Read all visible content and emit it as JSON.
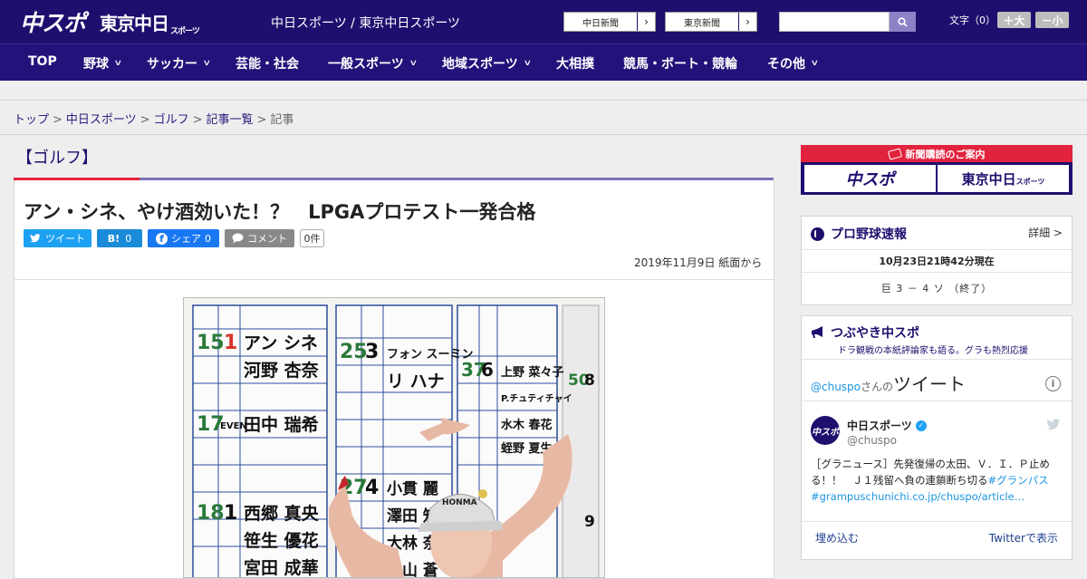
{
  "header": {
    "logo_chuspo": "中スポ",
    "logo_tokyo": "東京中日",
    "logo_tokyo_suffix": "スポーツ",
    "site_title": "中日スポーツ / 東京中日スポーツ",
    "paper_buttons": [
      {
        "label": "中日新聞",
        "arrow": "›"
      },
      {
        "label": "東京新聞",
        "arrow": "›"
      }
    ],
    "search": {
      "value": "",
      "placeholder": "",
      "icon": "search-icon"
    },
    "font_size_label": "文字（0）",
    "font_plus": "＋大",
    "font_minus": "－小"
  },
  "nav": [
    {
      "label": "TOP",
      "chevron": false
    },
    {
      "label": "野球",
      "chevron": true
    },
    {
      "label": "サッカー",
      "chevron": true
    },
    {
      "label": "芸能・社会",
      "chevron": false
    },
    {
      "label": "一般スポーツ",
      "chevron": true
    },
    {
      "label": "地域スポーツ",
      "chevron": true
    },
    {
      "label": "大相撲",
      "chevron": false
    },
    {
      "label": "競馬・ボート・競輪",
      "chevron": false
    },
    {
      "label": "その他",
      "chevron": true
    }
  ],
  "breadcrumb": [
    "トップ",
    "中日スポーツ",
    "ゴルフ",
    "記事一覧",
    "記事"
  ],
  "breadcrumb_sep": ">",
  "article": {
    "category": "【ゴルフ】",
    "headline": "アン・シネ、やけ酒効いた！？　LPGAプロテスト一発合格",
    "share": {
      "tweet": "ツイート",
      "hatena": "B!",
      "hatena_count": "0",
      "facebook": "シェア",
      "facebook_count": "0",
      "comment": "コメント",
      "comment_count": "0件"
    },
    "dateline": "2019年11月9日 紙面から",
    "photo": {
      "board_names_left": [
        "アン シネ",
        "河野 杏奈",
        "田中 瑞希",
        "西郷 真央",
        "笹生 優花",
        "宮田 成華"
      ],
      "board_ranks_left": [
        "15",
        "1",
        "17",
        "EVEN",
        "18",
        "1"
      ],
      "board_names_mid": [
        "フォン スーミン",
        "リ ハナ",
        "小貫 麗",
        "澤田 知佳",
        "大林 奈央",
        "安山 蒼"
      ],
      "board_ranks_mid": [
        "25",
        "3",
        "27",
        "4"
      ],
      "board_names_right": [
        "上野 菜々子",
        "P.チュティチャイ",
        "水木 春花",
        "蛭野 夏生"
      ],
      "board_ranks_right": [
        "37",
        "6",
        "50",
        "8",
        "9"
      ],
      "cap_text": "HONMA"
    }
  },
  "sidebar": {
    "subscription": {
      "head": "新聞購読のご案内",
      "left": "中スポ",
      "right": "東京中日",
      "right_suffix": "スポーツ"
    },
    "baseball": {
      "title": "プロ野球速報",
      "detail": "詳細 >",
      "time": "10月23日21時42分現在",
      "score": "巨 3 － 4 ソ （終了）"
    },
    "tsubuyaki": {
      "title": "つぶやき中スポ",
      "subtitle": "ドラ観戦の本紙評論家も語る。グラも熱烈応援",
      "handle_prefix": "@chuspo",
      "handle_suffix": "さんの",
      "tweets_label": "ツイート",
      "info": "i",
      "account_name": "中日スポーツ",
      "account_handle": "@chuspo",
      "avatar_text": "中スポ",
      "tweet_text": "［グラニュース］先発復帰の太田、Ｖ．Ｉ．Ｐ止める！！　Ｊ１残留へ負の連鎖断ち切る",
      "tweet_hashtag": "#グランパス",
      "tweet_link": "#grampuschunichi.co.jp/chuspo/article…",
      "embed": "埋め込む",
      "view_on_twitter": "Twitterで表示"
    }
  }
}
